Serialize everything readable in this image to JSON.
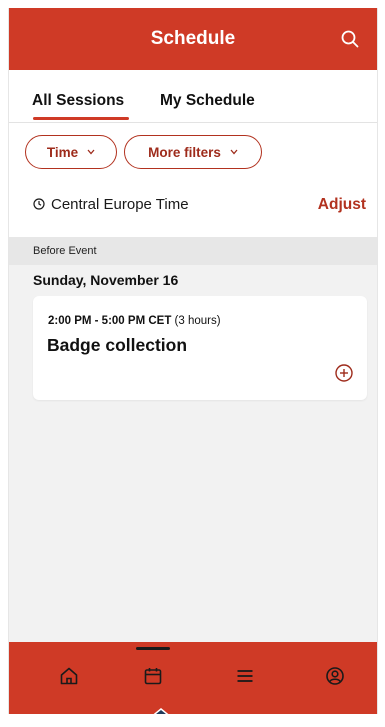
{
  "header": {
    "title": "Schedule",
    "search_icon": "search-icon"
  },
  "tabs": [
    {
      "label": "All Sessions",
      "active": true
    },
    {
      "label": "My Schedule",
      "active": false
    }
  ],
  "filters": {
    "time_label": "Time",
    "more_label": "More filters"
  },
  "timezone": {
    "icon": "clock-icon",
    "label": "Central Europe Time",
    "adjust_label": "Adjust"
  },
  "section": {
    "label": "Before Event",
    "day": "Sunday, November 16"
  },
  "sessions": [
    {
      "time": "2:00 PM - 5:00 PM CET",
      "duration": "(3 hours)",
      "title": "Badge collection",
      "add_icon": "add-circle-icon"
    }
  ],
  "bottom_nav": {
    "items": [
      {
        "icon": "home-icon",
        "active": false
      },
      {
        "icon": "calendar-icon",
        "active": true
      },
      {
        "icon": "menu-icon",
        "active": false
      },
      {
        "icon": "profile-icon",
        "active": false
      }
    ]
  },
  "colors": {
    "brand": "#cf3a26",
    "accent_text": "#b2321f",
    "background": "#f2f2f2"
  }
}
